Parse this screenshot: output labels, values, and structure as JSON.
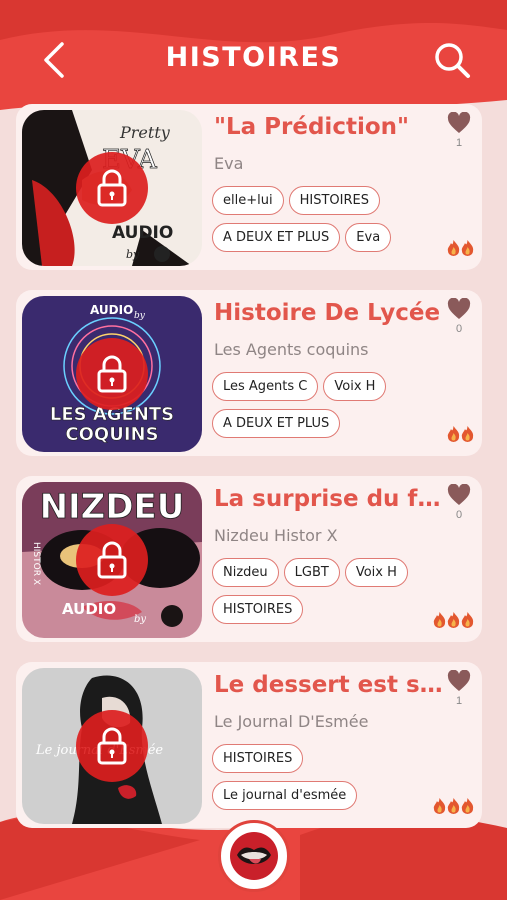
{
  "header": {
    "title": "HISTOIRES",
    "back_icon": "chevron-left-icon",
    "search_icon": "search-icon"
  },
  "colors": {
    "accent": "#e9453f",
    "title_red": "#e2564c",
    "card_bg": "#fcf0ef"
  },
  "stories": [
    {
      "title": "\"La Prédiction\"",
      "author": "Eva",
      "tags": [
        "elle+lui",
        "HISTOIRES",
        "A DEUX ET PLUS",
        "Eva"
      ],
      "likes": "1",
      "flames": 2,
      "cover_text": [
        "Pretty",
        "EVA",
        "AUDIO",
        "by"
      ]
    },
    {
      "title": "Histoire De Lycée",
      "author": "Les Agents coquins",
      "tags": [
        "Les Agents C",
        "Voix H",
        "A DEUX ET PLUS"
      ],
      "likes": "0",
      "flames": 2,
      "cover_text": [
        "AUDIO",
        "by",
        "LES AGENTS",
        "COQUINS"
      ]
    },
    {
      "title": "La surprise du fa...",
      "author": "Nizdeu Histor X",
      "tags": [
        "Nizdeu",
        "LGBT",
        "Voix H",
        "HISTOIRES"
      ],
      "likes": "0",
      "flames": 3,
      "cover_text": [
        "NIZDEU",
        "HISTOR X",
        "AUDIO",
        "by"
      ]
    },
    {
      "title": "Le dessert est se...",
      "author": "Le Journal D'Esmée",
      "tags": [
        "HISTOIRES",
        "Le journal d'esmée"
      ],
      "likes": "1",
      "flames": 3,
      "cover_text": [
        "Le journal d'Esmée"
      ]
    }
  ],
  "player": {
    "icon": "lips-logo-icon"
  }
}
